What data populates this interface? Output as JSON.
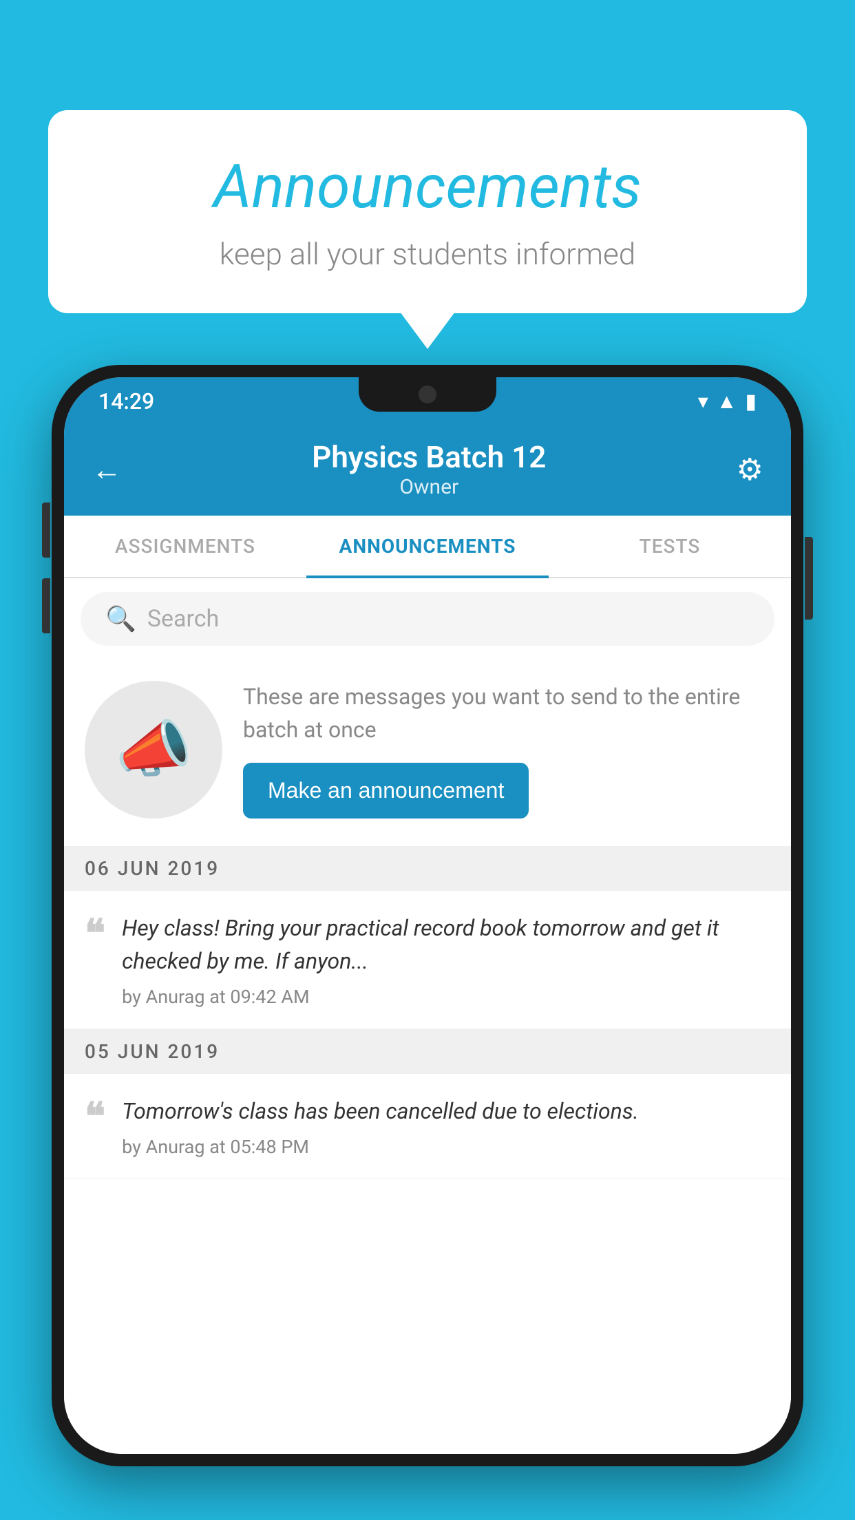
{
  "background_color": "#22BAE0",
  "speech_bubble": {
    "title": "Announcements",
    "subtitle": "keep all your students informed"
  },
  "phone": {
    "status_bar": {
      "time": "14:29",
      "icons": [
        "wifi",
        "signal",
        "battery"
      ]
    },
    "header": {
      "back_label": "←",
      "title": "Physics Batch 12",
      "subtitle": "Owner",
      "gear_label": "⚙"
    },
    "tabs": [
      {
        "label": "ASSIGNMENTS",
        "active": false
      },
      {
        "label": "ANNOUNCEMENTS",
        "active": true
      },
      {
        "label": "TESTS",
        "active": false
      }
    ],
    "search": {
      "placeholder": "Search"
    },
    "promo": {
      "description": "These are messages you want to send to the entire batch at once",
      "button_label": "Make an announcement"
    },
    "announcements": [
      {
        "date": "06  JUN  2019",
        "text": "Hey class! Bring your practical record book tomorrow and get it checked by me. If anyon...",
        "meta": "by Anurag at 09:42 AM"
      },
      {
        "date": "05  JUN  2019",
        "text": "Tomorrow's class has been cancelled due to elections.",
        "meta": "by Anurag at 05:48 PM"
      }
    ]
  }
}
